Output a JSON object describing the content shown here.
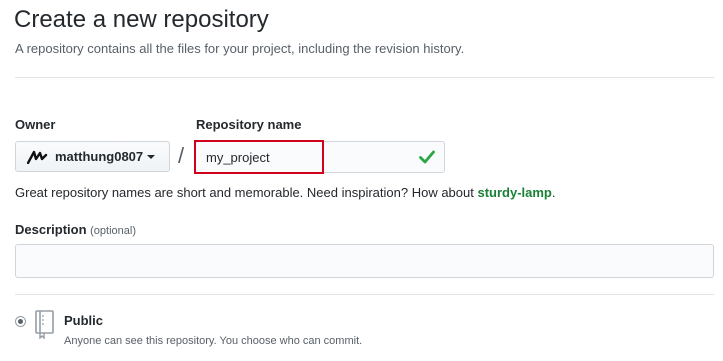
{
  "header": {
    "title": "Create a new repository",
    "subtitle": "A repository contains all the files for your project, including the revision history."
  },
  "form": {
    "owner_label": "Owner",
    "owner_value": "matthung0807",
    "slash": "/",
    "repo_name_label": "Repository name",
    "repo_name_value": "my_project",
    "hint_text": "Great repository names are short and memorable. Need inspiration? How about ",
    "hint_suggestion": "sturdy-lamp",
    "hint_end": ".",
    "description_label": "Description",
    "description_optional": "(optional)",
    "description_value": ""
  },
  "visibility": {
    "public_label": "Public",
    "public_desc": "Anyone can see this repository. You choose who can commit.",
    "public_selected": true
  },
  "colors": {
    "highlight": "#d0021b",
    "valid_check": "#28a745",
    "suggestion_link": "#1a7f37"
  },
  "icons": {
    "owner_avatar": "owner-logo-icon",
    "valid": "check-icon",
    "public": "repo-book-icon"
  }
}
